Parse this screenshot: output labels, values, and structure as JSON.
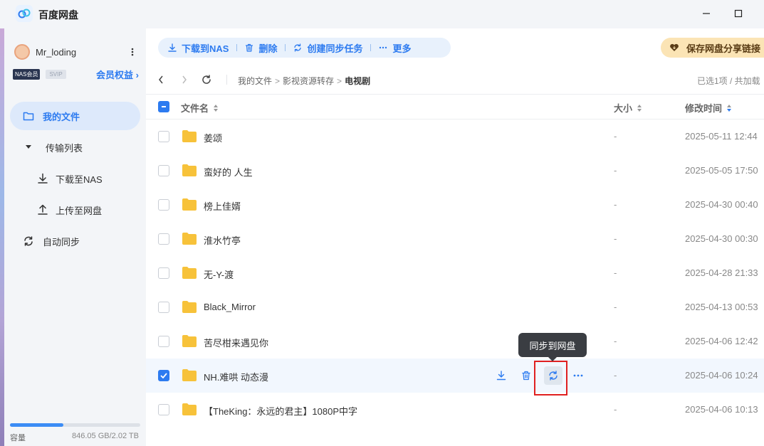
{
  "app": {
    "title": "百度网盘"
  },
  "user": {
    "name": "Mr_loding",
    "badge_nas": "NAS会员",
    "badge_svip": "SVIP",
    "member_link": "会员权益"
  },
  "sidebar": {
    "items": [
      {
        "label": "我的文件",
        "icon": "folder-icon"
      },
      {
        "label": "传输列表",
        "icon": "caret-down-icon"
      },
      {
        "label": "下载至NAS",
        "icon": "download-icon"
      },
      {
        "label": "上传至网盘",
        "icon": "upload-icon"
      },
      {
        "label": "自动同步",
        "icon": "sync-icon"
      }
    ],
    "storage_label": "容量",
    "storage_value": "846.05 GB/2.02 TB",
    "storage_fraction": 0.41
  },
  "toolbar": {
    "download": "下载到NAS",
    "delete": "删除",
    "sync_task": "创建同步任务",
    "more": "更多",
    "save_share": "保存网盘分享链接"
  },
  "breadcrumb": [
    "我的文件",
    "影视资源转存",
    "电视剧"
  ],
  "selection_info": "已选1项 / 共加载",
  "columns": {
    "name": "文件名",
    "size": "大小",
    "modified": "修改时间"
  },
  "tooltip": "同步到网盘",
  "files": [
    {
      "name": "姜颂",
      "size": "-",
      "date": "2025-05-11 12:44",
      "checked": false
    },
    {
      "name": "蛮好的 人生",
      "size": "-",
      "date": "2025-05-05 17:50",
      "checked": false
    },
    {
      "name": "榜上佳婿",
      "size": "-",
      "date": "2025-04-30 00:40",
      "checked": false
    },
    {
      "name": "淮水竹亭",
      "size": "-",
      "date": "2025-04-30 00:30",
      "checked": false
    },
    {
      "name": "无-Y-渡",
      "size": "-",
      "date": "2025-04-28 21:33",
      "checked": false
    },
    {
      "name": "Black_Mirror",
      "size": "-",
      "date": "2025-04-13 00:53",
      "checked": false
    },
    {
      "name": "苦尽柑来遇见你",
      "size": "-",
      "date": "2025-04-06 12:42",
      "checked": false
    },
    {
      "name": "NH.难哄 动态漫",
      "size": "-",
      "date": "2025-04-06 10:24",
      "checked": true
    },
    {
      "name": "【TheKing：永远的君主】1080P中字",
      "size": "-",
      "date": "2025-04-06 10:13",
      "checked": false
    }
  ],
  "colors": {
    "accent": "#2d7bf0",
    "folder": "#f7c23a",
    "highlight": "#e02020"
  }
}
